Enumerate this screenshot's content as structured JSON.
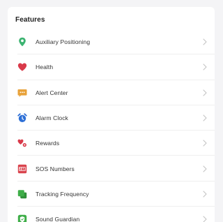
{
  "section": {
    "title": "Features"
  },
  "items": [
    {
      "label": "Auxiliary Positioning",
      "icon": "location-pin-icon",
      "color": "#3cb371"
    },
    {
      "label": "Health",
      "icon": "heart-icon",
      "color": "#d93a4a"
    },
    {
      "label": "Alert Center",
      "icon": "message-bubble-icon",
      "color": "#e8a23a"
    },
    {
      "label": "Alarm Clock",
      "icon": "alarm-clock-icon",
      "color": "#2d6fd6"
    },
    {
      "label": "Rewards",
      "icon": "rewards-icon",
      "color": "#d93a4a"
    },
    {
      "label": "SOS Numbers",
      "icon": "sos-icon",
      "color": "#d9434d"
    },
    {
      "label": "Tracking Frequency",
      "icon": "tracking-frequency-icon",
      "color": "#3fae49"
    },
    {
      "label": "Sound Guardian",
      "icon": "shield-icon",
      "color": "#3fae49"
    }
  ]
}
